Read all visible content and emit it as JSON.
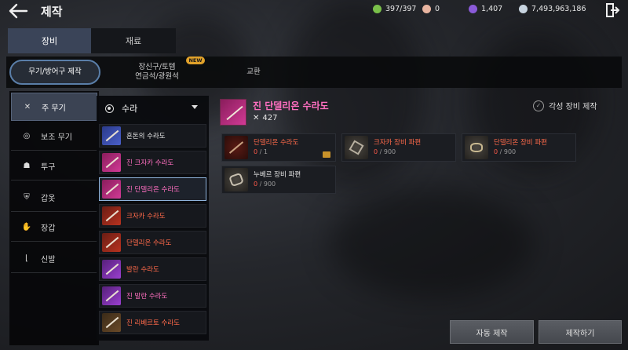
{
  "header": {
    "title": "제작",
    "currencies": [
      {
        "icon": "energy-icon",
        "value": "397/397",
        "color": "#7ac04a"
      },
      {
        "icon": "gem-icon",
        "value": "0",
        "color": "#e8b4a0"
      },
      {
        "icon": "crystal-icon",
        "value": "1,407",
        "color": "#8a5ad8"
      },
      {
        "icon": "silver-icon",
        "value": "7,493,963,186",
        "color": "#c8d4e0"
      }
    ]
  },
  "main_tabs": [
    {
      "label": "장비",
      "active": true
    },
    {
      "label": "재료",
      "active": false
    }
  ],
  "sub_tabs": [
    {
      "label": "무기/방어구 제작",
      "active": true
    },
    {
      "line1": "장신구/토템",
      "line2": "연금석/광원석",
      "badge": "NEW"
    },
    {
      "label": "교환"
    }
  ],
  "categories": [
    {
      "label": "주 무기",
      "icon": "crossed-swords-icon",
      "active": true
    },
    {
      "label": "보조 무기",
      "icon": "target-icon"
    },
    {
      "label": "투구",
      "icon": "helmet-icon"
    },
    {
      "label": "갑옷",
      "icon": "armor-icon"
    },
    {
      "label": "장갑",
      "icon": "glove-icon"
    },
    {
      "label": "신발",
      "icon": "boot-icon"
    }
  ],
  "weapon_select": {
    "value": "수라"
  },
  "items": [
    {
      "label": "혼돈의 수라도",
      "tone": "white",
      "thumb": "blue"
    },
    {
      "label": "진 크자카 수라도",
      "tone": "pink",
      "thumb": "pink"
    },
    {
      "label": "진 단델리온 수라도",
      "tone": "pink",
      "thumb": "pink",
      "selected": true
    },
    {
      "label": "크자카 수라도",
      "tone": "red",
      "thumb": "red"
    },
    {
      "label": "단델리온 수라도",
      "tone": "red",
      "thumb": "red"
    },
    {
      "label": "발란 수라도",
      "tone": "red",
      "thumb": "purple"
    },
    {
      "label": "진 발란 수라도",
      "tone": "pink",
      "thumb": "purple"
    },
    {
      "label": "진 리베르토 수라도",
      "tone": "red",
      "thumb": "brown"
    }
  ],
  "detail": {
    "name": "진 단델리온 수라도",
    "power": "427",
    "awaken_label": "각성 장비 제작"
  },
  "materials": [
    {
      "name": "단델리온 수라도",
      "have": "0",
      "need": "/ 1",
      "tone": "red"
    },
    {
      "name": "크자카 장비 파편",
      "have": "0",
      "need": "/ 900",
      "tone": "red"
    },
    {
      "name": "단델리온 장비 파편",
      "have": "0",
      "need": "/ 900",
      "tone": "red"
    },
    {
      "name": "누베르 장비 파편",
      "have": "0",
      "need": "/ 900",
      "tone": "white"
    }
  ],
  "buttons": {
    "auto": "자동 제작",
    "craft": "제작하기"
  }
}
